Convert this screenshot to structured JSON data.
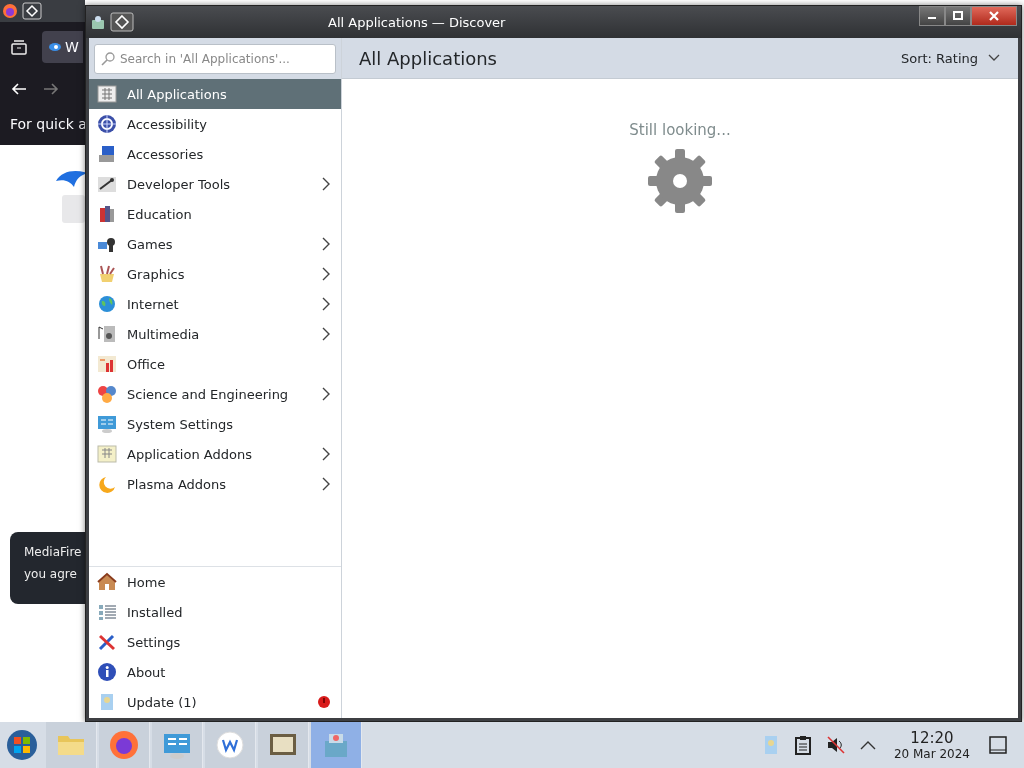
{
  "background_window": {
    "tab_label": "W",
    "notice": "For quick a",
    "toast_lines": [
      "MediaFire",
      "you agre"
    ]
  },
  "window": {
    "title": "All Applications — Discover",
    "search": {
      "placeholder": "Search in 'All Applications'..."
    },
    "categories": [
      {
        "label": "All Applications",
        "selected": true,
        "expandable": false
      },
      {
        "label": "Accessibility",
        "selected": false,
        "expandable": false
      },
      {
        "label": "Accessories",
        "selected": false,
        "expandable": false
      },
      {
        "label": "Developer Tools",
        "selected": false,
        "expandable": true
      },
      {
        "label": "Education",
        "selected": false,
        "expandable": false
      },
      {
        "label": "Games",
        "selected": false,
        "expandable": true
      },
      {
        "label": "Graphics",
        "selected": false,
        "expandable": true
      },
      {
        "label": "Internet",
        "selected": false,
        "expandable": true
      },
      {
        "label": "Multimedia",
        "selected": false,
        "expandable": true
      },
      {
        "label": "Office",
        "selected": false,
        "expandable": false
      },
      {
        "label": "Science and Engineering",
        "selected": false,
        "expandable": true
      },
      {
        "label": "System Settings",
        "selected": false,
        "expandable": false
      },
      {
        "label": "Application Addons",
        "selected": false,
        "expandable": true
      },
      {
        "label": "Plasma Addons",
        "selected": false,
        "expandable": true
      }
    ],
    "pages": [
      {
        "label": "Home",
        "alert": false
      },
      {
        "label": "Installed",
        "alert": false
      },
      {
        "label": "Settings",
        "alert": false
      },
      {
        "label": "About",
        "alert": false
      },
      {
        "label": "Update (1)",
        "alert": true
      }
    ],
    "heading": "All Applications",
    "sort": "Sort: Rating",
    "status": "Still looking..."
  },
  "taskbar": {
    "tasks": [
      {
        "selected": false
      },
      {
        "selected": false
      },
      {
        "selected": false
      },
      {
        "selected": false
      },
      {
        "selected": false
      },
      {
        "selected": true
      }
    ],
    "time": "12:20",
    "date": "20 Mar 2024"
  }
}
